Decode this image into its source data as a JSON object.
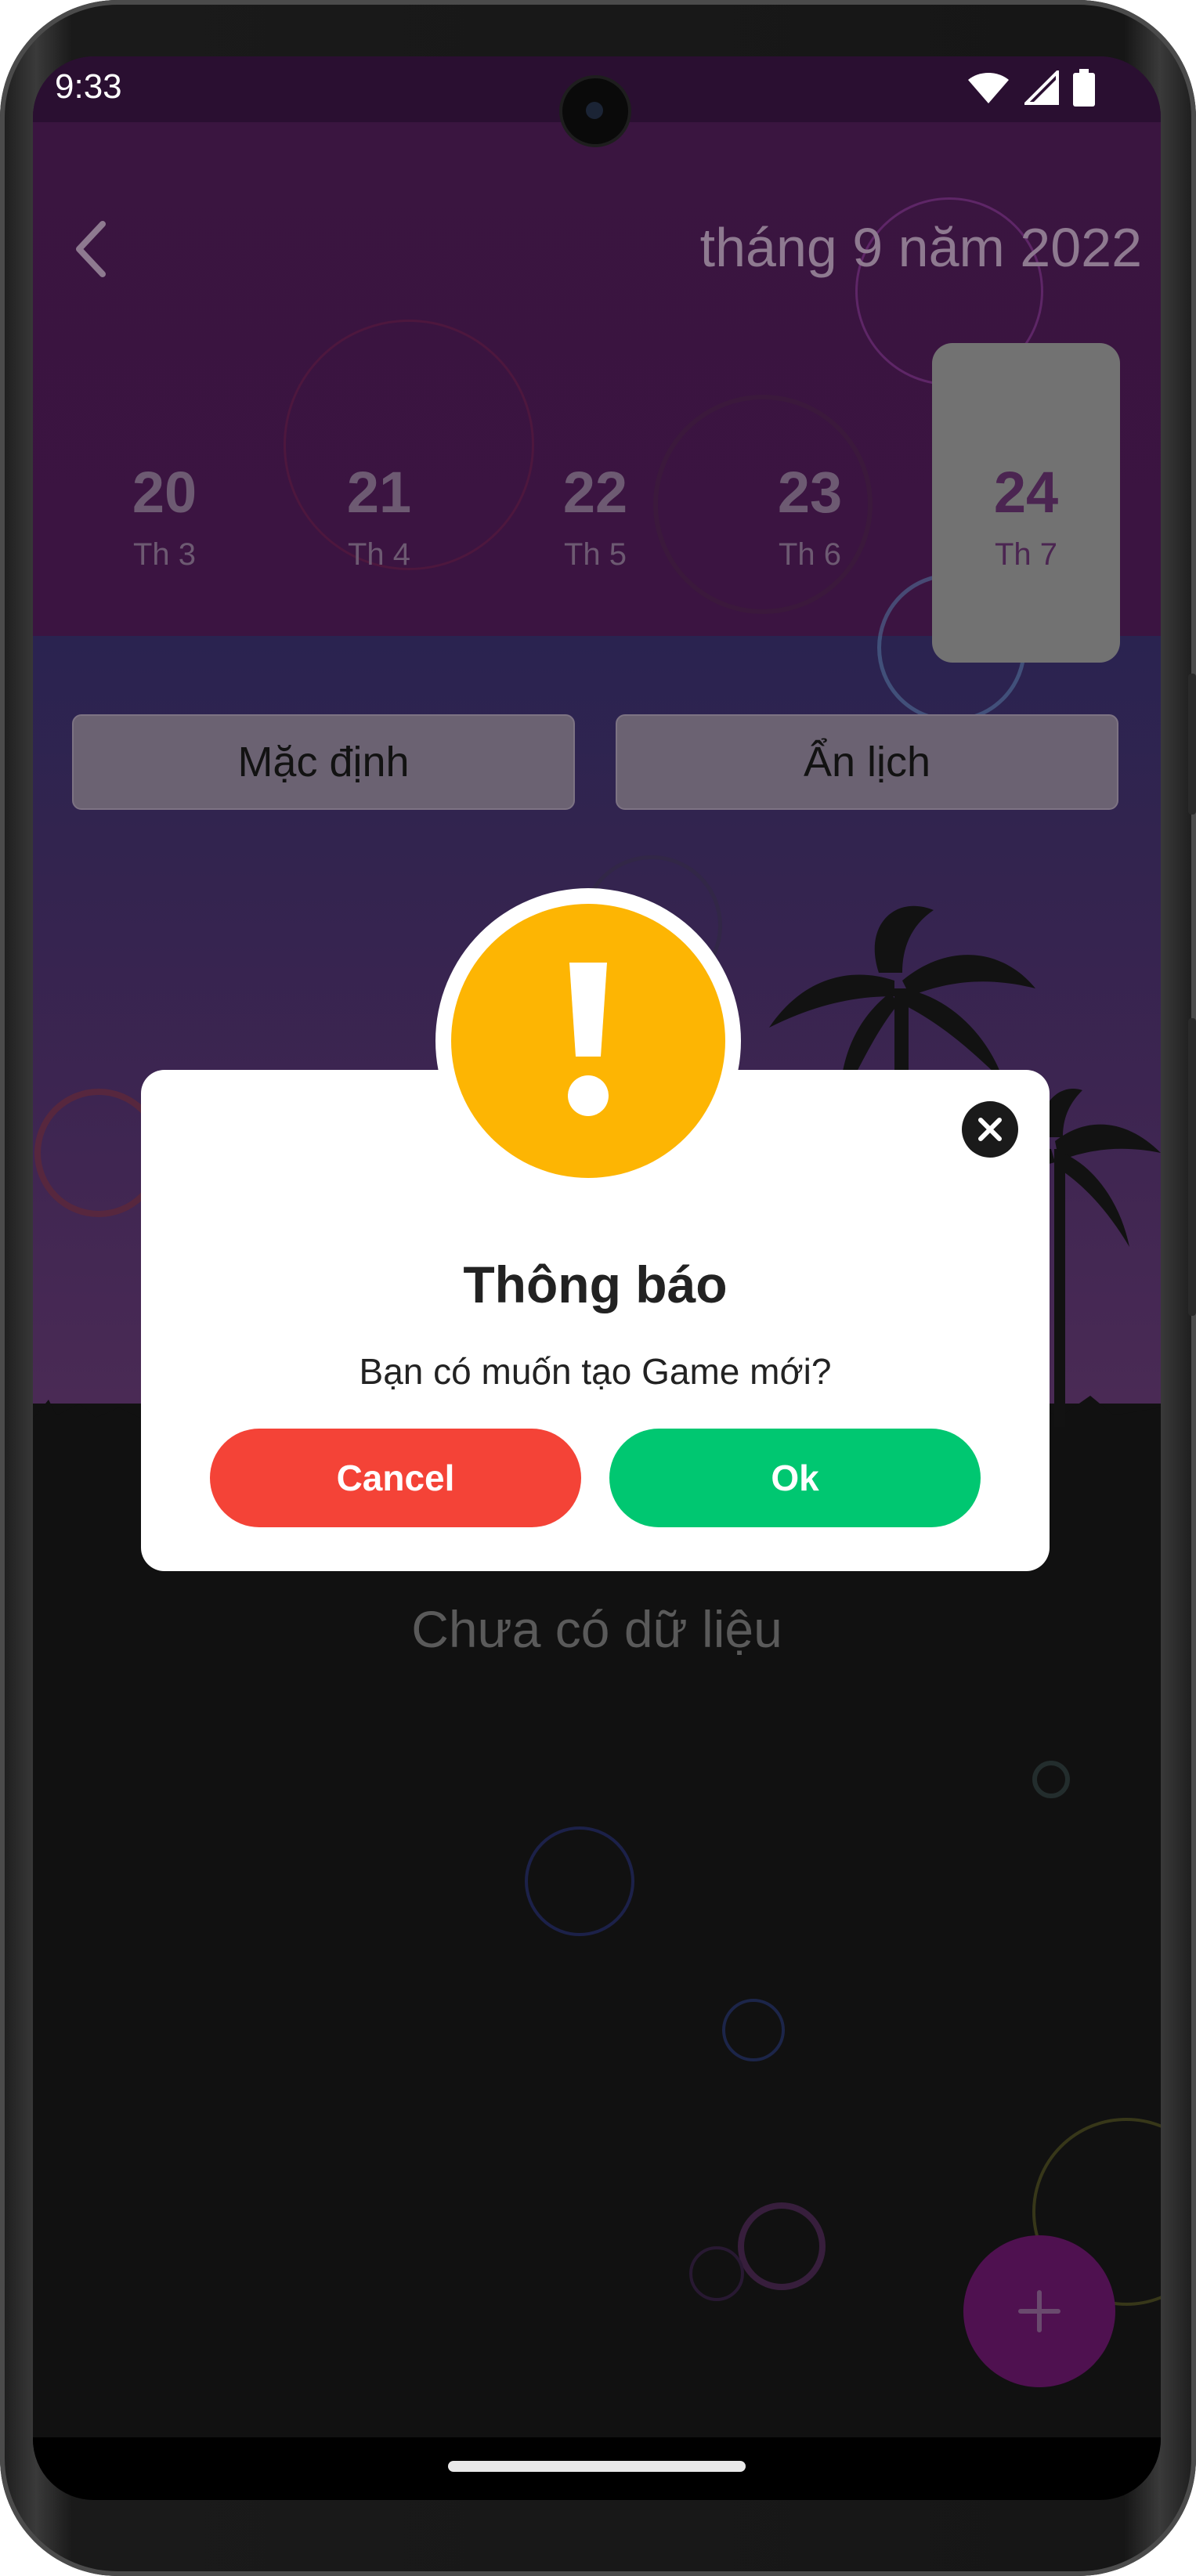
{
  "status_bar": {
    "time": "9:33"
  },
  "header": {
    "month_title": "tháng 9 năm 2022"
  },
  "date_strip": {
    "items": [
      {
        "day": "20",
        "weekday": "Th 3"
      },
      {
        "day": "21",
        "weekday": "Th 4"
      },
      {
        "day": "22",
        "weekday": "Th 5"
      },
      {
        "day": "23",
        "weekday": "Th 6"
      },
      {
        "day": "24",
        "weekday": "Th 7"
      }
    ],
    "selected_day": "24"
  },
  "mode_buttons": {
    "default_label": "Mặc định",
    "hide_calendar_label": "Ẩn lịch"
  },
  "empty_state": {
    "text": "Chưa có dữ liệu"
  },
  "dialog": {
    "title": "Thông báo",
    "message": "Bạn có muốn tạo Game mới?",
    "cancel_label": "Cancel",
    "ok_label": "Ok",
    "icon": "warning-exclamation-icon"
  },
  "fab": {
    "icon": "plus-icon"
  },
  "colors": {
    "accent_purple": "#4f1150",
    "warning_yellow": "#fdb503",
    "cancel_red": "#f44337",
    "ok_green": "#00c771"
  }
}
